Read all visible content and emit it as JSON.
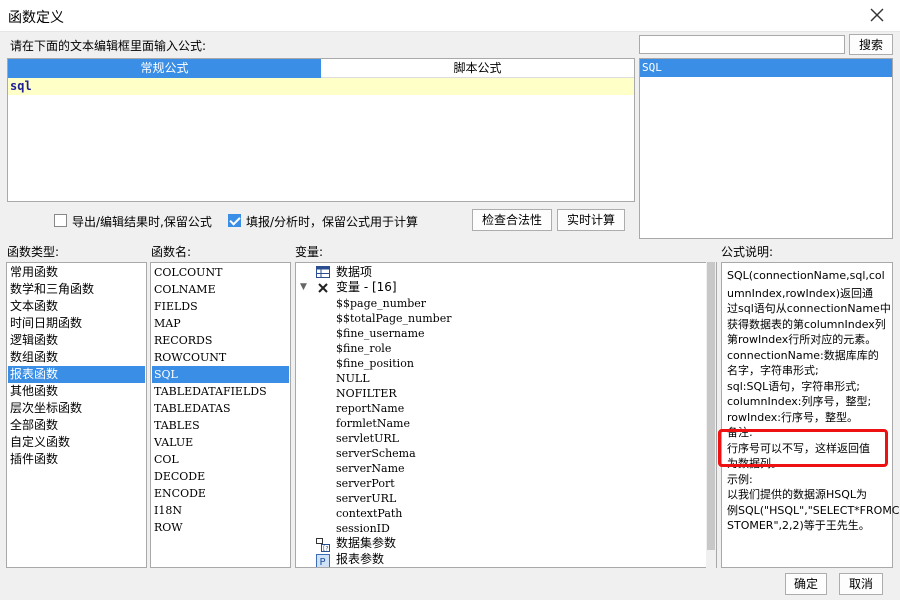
{
  "window": {
    "title": "函数定义"
  },
  "prompt": "请在下面的文本编辑框里面输入公式:",
  "search": {
    "value": "",
    "button": "搜索"
  },
  "editor": {
    "tabs": [
      "常规公式",
      "脚本公式"
    ],
    "code": "sql"
  },
  "right_list": {
    "items": [
      "SQL"
    ]
  },
  "options": {
    "export_keep": {
      "label": "导出/编辑结果时,保留公式",
      "checked": false
    },
    "fill_keep": {
      "label": "填报/分析时，保留公式用于计算",
      "checked": true
    },
    "check_button": "检查合法性",
    "realtime_button": "实时计算"
  },
  "sections": {
    "types": "函数类型:",
    "names": "函数名:",
    "vars": "变量:",
    "desc": "公式说明:"
  },
  "types": [
    "常用函数",
    "数学和三角函数",
    "文本函数",
    "时间日期函数",
    "逻辑函数",
    "数组函数",
    "报表函数",
    "其他函数",
    "层次坐标函数",
    "全部函数",
    "自定义函数",
    "插件函数"
  ],
  "types_selected": 6,
  "names": [
    "COLCOUNT",
    "COLNAME",
    "FIELDS",
    "MAP",
    "RECORDS",
    "ROWCOUNT",
    "SQL",
    "TABLEDATAFIELDS",
    "TABLEDATAS",
    "TABLES",
    "VALUE",
    "COL",
    "DECODE",
    "ENCODE",
    "I18N",
    "ROW"
  ],
  "names_selected": 6,
  "vars": {
    "data_item": "数据项",
    "var_group": "变量 - [16]",
    "items": [
      "$$page_number",
      "$$totalPage_number",
      "$fine_username",
      "$fine_role",
      "$fine_position",
      "NULL",
      "NOFILTER",
      "reportName",
      "formletName",
      "servletURL",
      "serverSchema",
      "serverName",
      "serverPort",
      "serverURL",
      "contextPath",
      "sessionID"
    ],
    "dataset_params": "数据集参数",
    "report_params": "报表参数"
  },
  "description": [
    "SQL(connectionName,sql,col",
    "umnIndex,rowIndex)返回通",
    "过sql语句从connectionName中",
    "获得数据表的第columnIndex列",
    "第rowIndex行所对应的元素。",
    "connectionName:数据库库的",
    "名字，字符串形式;",
    "sql:SQL语句，字符串形式;",
    "columnIndex:列序号，整型;",
    "rowIndex:行序号，整型。",
    "备注:",
    "行序号可以不写，这样返回值",
    "为数据列。",
    "示例:",
    "以我们提供的数据源HSQL为",
    "例SQL(\"HSQL\",\"SELECT*FROMCU",
    "STOMER\",2,2)等于王先生。"
  ],
  "footer": {
    "ok": "确定",
    "cancel": "取消"
  }
}
